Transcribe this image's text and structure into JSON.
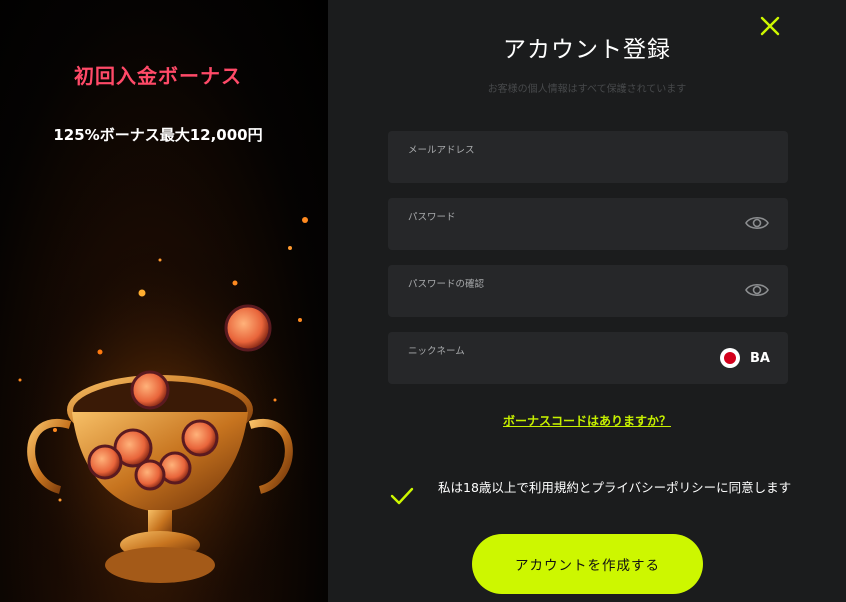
{
  "promo": {
    "title": "初回入金ボーナス",
    "subtitle": "125%ボーナス最大12,000円"
  },
  "form": {
    "title": "アカウント登録",
    "subtitle": "お客様の個人情報はすべて保護されています",
    "email_label": "メールアドレス",
    "email_value": "",
    "password_label": "パスワード",
    "password_value": "",
    "password_confirm_label": "パスワードの確認",
    "password_confirm_value": "",
    "nickname_label": "ニックネーム",
    "nickname_value": "",
    "country_code": "BA",
    "bonus_code_link": "ボーナスコードはありますか？",
    "agree_text": "私は18歳以上で利用規約とプライバシーポリシーに同意します",
    "agree_checked": true,
    "submit_label": "アカウントを作成する"
  },
  "icons": {
    "close": "close-icon",
    "password_eye": "eye-icon",
    "confirm_eye": "eye-icon",
    "flag": "flag-icon",
    "check": "check-icon"
  },
  "colors": {
    "accent": "#cdf700",
    "promo_title": "#ff4a68",
    "panel_bg": "#1b1c1d",
    "field_bg": "#262729",
    "link": "#c7f000"
  }
}
